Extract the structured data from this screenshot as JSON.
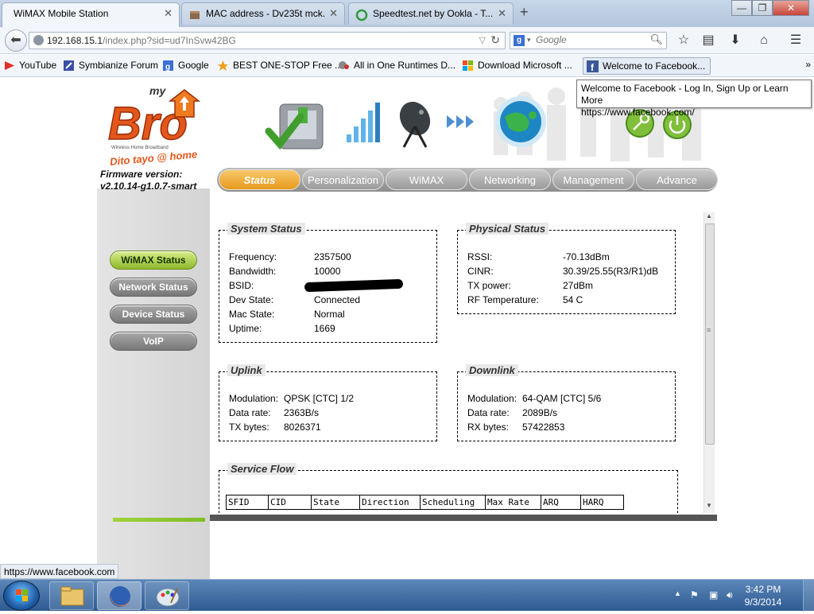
{
  "browser": {
    "tabs": [
      {
        "label": "WiMAX Mobile Station",
        "active": true
      },
      {
        "label": "MAC address - Dv235t mck...",
        "active": false
      },
      {
        "label": "Speedtest.net by Ookla - T...",
        "active": false
      }
    ],
    "new_tab_label": "+",
    "window_controls": {
      "minimize": "—",
      "maximize": "❐",
      "close": "✕"
    },
    "url_host": "192.168.15.1",
    "url_path": "/index.php?sid=ud7InSvw42BG",
    "search_placeholder": "Google",
    "search_engine_letter": "g",
    "bookmarks": [
      {
        "label": "YouTube",
        "icon": "youtube-icon",
        "color": "#e52d27"
      },
      {
        "label": "Symbianize Forum",
        "icon": "symbianize-icon",
        "color": "#3a4fa8"
      },
      {
        "label": "Google",
        "icon": "google-icon",
        "color": "#3b6fd6"
      },
      {
        "label": "BEST ONE-STOP Free ...",
        "icon": "orange-star-icon",
        "color": "#f0a020"
      },
      {
        "label": "All in One Runtimes D...",
        "icon": "runtimes-icon",
        "color": "#777777"
      },
      {
        "label": "Download Microsoft ...",
        "icon": "microsoft-icon",
        "color": "#f25022"
      },
      {
        "label": "Welcome to Facebook...",
        "icon": "facebook-icon",
        "color": "#3b5998",
        "active": true
      }
    ],
    "bookmarks_more": "»",
    "tooltip": {
      "line1": "Welcome to Facebook - Log In, Sign Up or Learn More",
      "line2": "https://www.facebook.com/"
    },
    "status_url": "https://www.facebook.com"
  },
  "router": {
    "brand_small": "my",
    "brand": "Bro",
    "brand_sub": "Wireless Home Broadband",
    "tagline": "Dito tayo @ home",
    "firmware_label": "Firmware version:",
    "firmware_value": "v2.10.14-g1.0.7-smart",
    "nav_tabs": [
      "Status",
      "Personalization",
      "WiMAX",
      "Networking",
      "Management",
      "Advance"
    ],
    "active_tab": "Status",
    "side_buttons": [
      "WiMAX Status",
      "Network Status",
      "Device Status",
      "VoIP"
    ],
    "active_side_button": "WiMAX Status",
    "accent_color": "#e89a1b",
    "active_side_color": "#8eb82a",
    "system_status": {
      "title": "System Status",
      "rows": [
        {
          "label": "Frequency:",
          "value": "2357500"
        },
        {
          "label": "Bandwidth:",
          "value": "10000"
        },
        {
          "label": "BSID:",
          "value": ""
        },
        {
          "label": "Dev State:",
          "value": "Connected"
        },
        {
          "label": "Mac State:",
          "value": "Normal"
        },
        {
          "label": "Uptime:",
          "value": "1669"
        }
      ]
    },
    "physical_status": {
      "title": "Physical Status",
      "rows": [
        {
          "label": "RSSI:",
          "value": "-70.13dBm"
        },
        {
          "label": "CINR:",
          "value": "30.39/25.55(R3/R1)dB"
        },
        {
          "label": "TX power:",
          "value": "27dBm"
        },
        {
          "label": "RF Temperature:",
          "value": "54 C"
        }
      ]
    },
    "uplink": {
      "title": "Uplink",
      "rows": [
        {
          "label": "Modulation:",
          "value": "QPSK [CTC] 1/2"
        },
        {
          "label": "Data rate:",
          "value": "2363B/s"
        },
        {
          "label": "TX bytes:",
          "value": "8026371"
        }
      ]
    },
    "downlink": {
      "title": "Downlink",
      "rows": [
        {
          "label": "Modulation:",
          "value": "64-QAM [CTC] 5/6"
        },
        {
          "label": "Data rate:",
          "value": "2089B/s"
        },
        {
          "label": "RX bytes:",
          "value": "57422853"
        }
      ]
    },
    "service_flow": {
      "title": "Service Flow",
      "columns": [
        "SFID",
        "CID",
        "State",
        "Direction",
        "Scheduling",
        "Max Rate",
        "ARQ",
        "HARQ"
      ]
    }
  },
  "taskbar": {
    "time": "3:42 PM",
    "date": "9/3/2014",
    "tray_arrow": "▲"
  }
}
